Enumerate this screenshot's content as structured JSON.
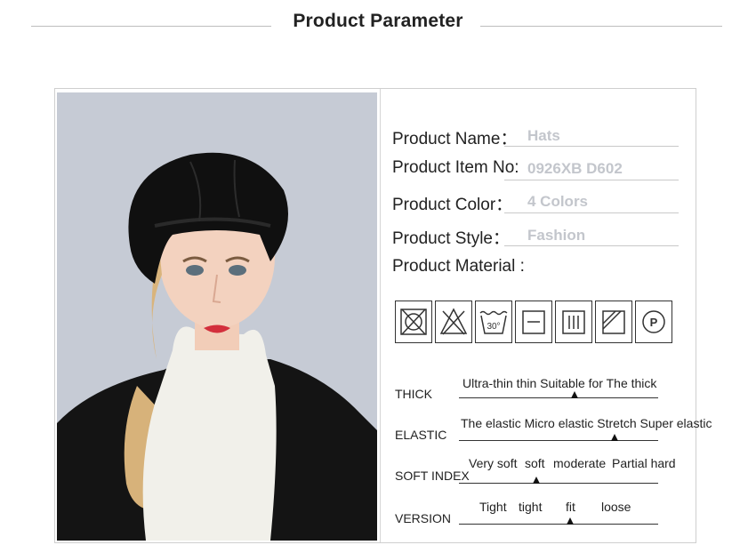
{
  "header": {
    "title": "Product Parameter"
  },
  "params": [
    {
      "label": "Product Name：",
      "value": "Hats"
    },
    {
      "label": "Product Item No:",
      "value": "0926XB D602"
    },
    {
      "label": "Product  Color：",
      "value": "4 Colors"
    },
    {
      "label": "Product Style：",
      "value": "Fashion"
    },
    {
      "label": "Product Material :",
      "value": ""
    }
  ],
  "care_icons": [
    "no-tumble-dry-icon",
    "no-bleach-icon",
    "wash-30-icon",
    "dry-flat-icon",
    "drip-dry-icon",
    "shade-dry-icon",
    "professional-cleaning-p-icon"
  ],
  "care_wash_temp": "30°",
  "care_pro_letter": "P",
  "scales": [
    {
      "name": "THICK",
      "options": "Ultra-thin thin Suitable for The thick",
      "selected_fraction": 0.58
    },
    {
      "name": "ELASTIC",
      "options": "The elastic Micro elastic Stretch Super elastic",
      "selected_fraction": 0.78
    },
    {
      "name": "SOFT INDEX",
      "options": [
        "Very soft",
        "soft",
        "moderate",
        "Partial hard"
      ],
      "selected_fraction": 0.39
    },
    {
      "name": "VERSION",
      "options": [
        "Tight",
        "tight",
        "fit",
        "loose"
      ],
      "selected_fraction": 0.56
    }
  ]
}
